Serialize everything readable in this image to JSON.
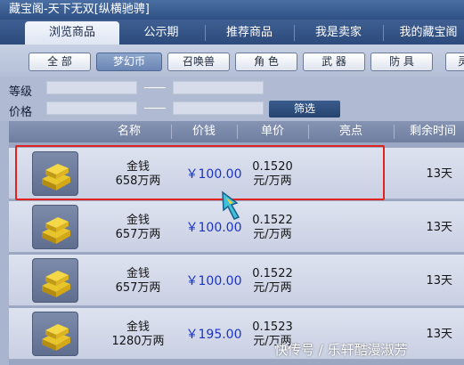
{
  "window": {
    "title": "藏宝阁-天下无双[纵横驰骋]"
  },
  "tabs": [
    {
      "label": "浏览商品",
      "active": true
    },
    {
      "label": "公示期",
      "active": false
    },
    {
      "label": "推荐商品",
      "active": false
    },
    {
      "label": "我是卖家",
      "active": false
    },
    {
      "label": "我的藏宝阁",
      "active": false
    }
  ],
  "categories": [
    {
      "label": "全 部",
      "active": false
    },
    {
      "label": "梦幻币",
      "active": true
    },
    {
      "label": "召唤兽",
      "active": false
    },
    {
      "label": "角 色",
      "active": false
    },
    {
      "label": "武 器",
      "active": false
    },
    {
      "label": "防 具",
      "active": false
    },
    {
      "label": "灵",
      "active": false
    }
  ],
  "filter": {
    "level_label": "等级",
    "price_label": "价格",
    "button_label": "筛选"
  },
  "table": {
    "headers": [
      "名称",
      "价钱",
      "单价",
      "亮点",
      "剩余时间"
    ],
    "rows": [
      {
        "name_line1": "金钱",
        "name_line2": "658万两",
        "price": "￥100.00",
        "unit_line1": "0.1520",
        "unit_line2": "元/万两",
        "highlight": "",
        "time": "13天"
      },
      {
        "name_line1": "金钱",
        "name_line2": "657万两",
        "price": "￥100.00",
        "unit_line1": "0.1522",
        "unit_line2": "元/万两",
        "highlight": "",
        "time": "13天"
      },
      {
        "name_line1": "金钱",
        "name_line2": "657万两",
        "price": "￥100.00",
        "unit_line1": "0.1522",
        "unit_line2": "元/万两",
        "highlight": "",
        "time": "13天"
      },
      {
        "name_line1": "金钱",
        "name_line2": "1280万两",
        "price": "￥195.00",
        "unit_line1": "0.1523",
        "unit_line2": "元/万两",
        "highlight": "",
        "time": "13天"
      }
    ]
  },
  "watermark": "快传号 / 乐轩酷漫淑芳",
  "colors": {
    "price": "#1b34c4",
    "highlight_box": "#e0231e",
    "tab_bar": "#2f5083"
  }
}
